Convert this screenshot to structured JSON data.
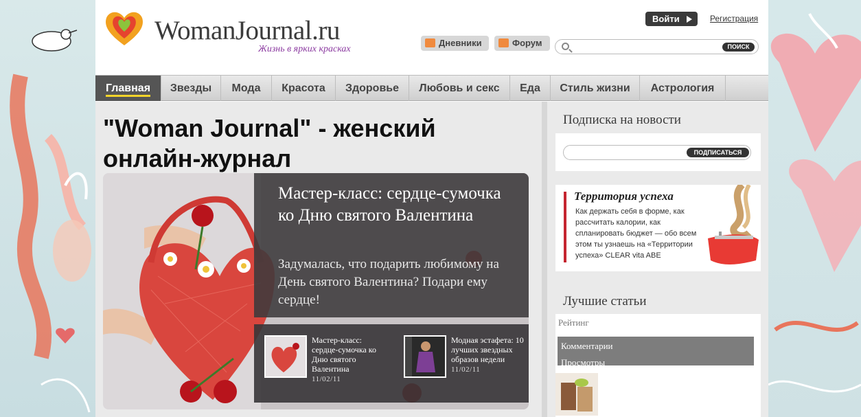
{
  "header": {
    "logo_text": "WomanJournal.ru",
    "tagline": "Жизнь в ярких красках",
    "login_label": "Войти",
    "register_label": "Регистрация",
    "diaries_label": "Дневники",
    "forum_label": "Форум",
    "search": {
      "value": "",
      "button_label": "ПОИСК"
    }
  },
  "nav": {
    "items": [
      "Главная",
      "Звезды",
      "Мода",
      "Красота",
      "Здоровье",
      "Любовь и секс",
      "Еда",
      "Стиль жизни",
      "Астрология"
    ],
    "active": "Главная"
  },
  "main": {
    "headline": "\"Woman Journal\" - женский онлайн-журнал",
    "feature": {
      "title": "Мастер-класс: сердце-сумочка ко Дню святого Валентина",
      "description": "Задумалась, что подарить любимому на День святого Валентина? Подари ему сердце!"
    },
    "thumbs": [
      {
        "title": "Мастер-класс: сердце-сумочка ко Дню святого Валентина",
        "date": "11/02/11"
      },
      {
        "title": "Модная эстафета: 10 лучших звездных образов недели",
        "date": "11/02/11"
      }
    ]
  },
  "sidebar": {
    "subscribe": {
      "title": "Подписка на новости",
      "input_value": "",
      "button_label": "ПОДПИСАТЬСЯ"
    },
    "promo": {
      "title": "Территория успеха",
      "text": "Как держать себя в форме, как рассчитать калории, как спланировать бюджет — обо всем этом ты узнаешь на «Территории успеха» CLEAR vita ABE"
    },
    "best": {
      "title": "Лучшие статьи",
      "tab_rating": "Рейтинг",
      "tab_comments": "Комментарии",
      "tab_views": "Просмотры"
    }
  },
  "colors": {
    "nav_active_bg": "#555555",
    "nav_active_underline": "#f7d52a",
    "accent_orange": "#f08a3e",
    "promo_red": "#c52530"
  }
}
